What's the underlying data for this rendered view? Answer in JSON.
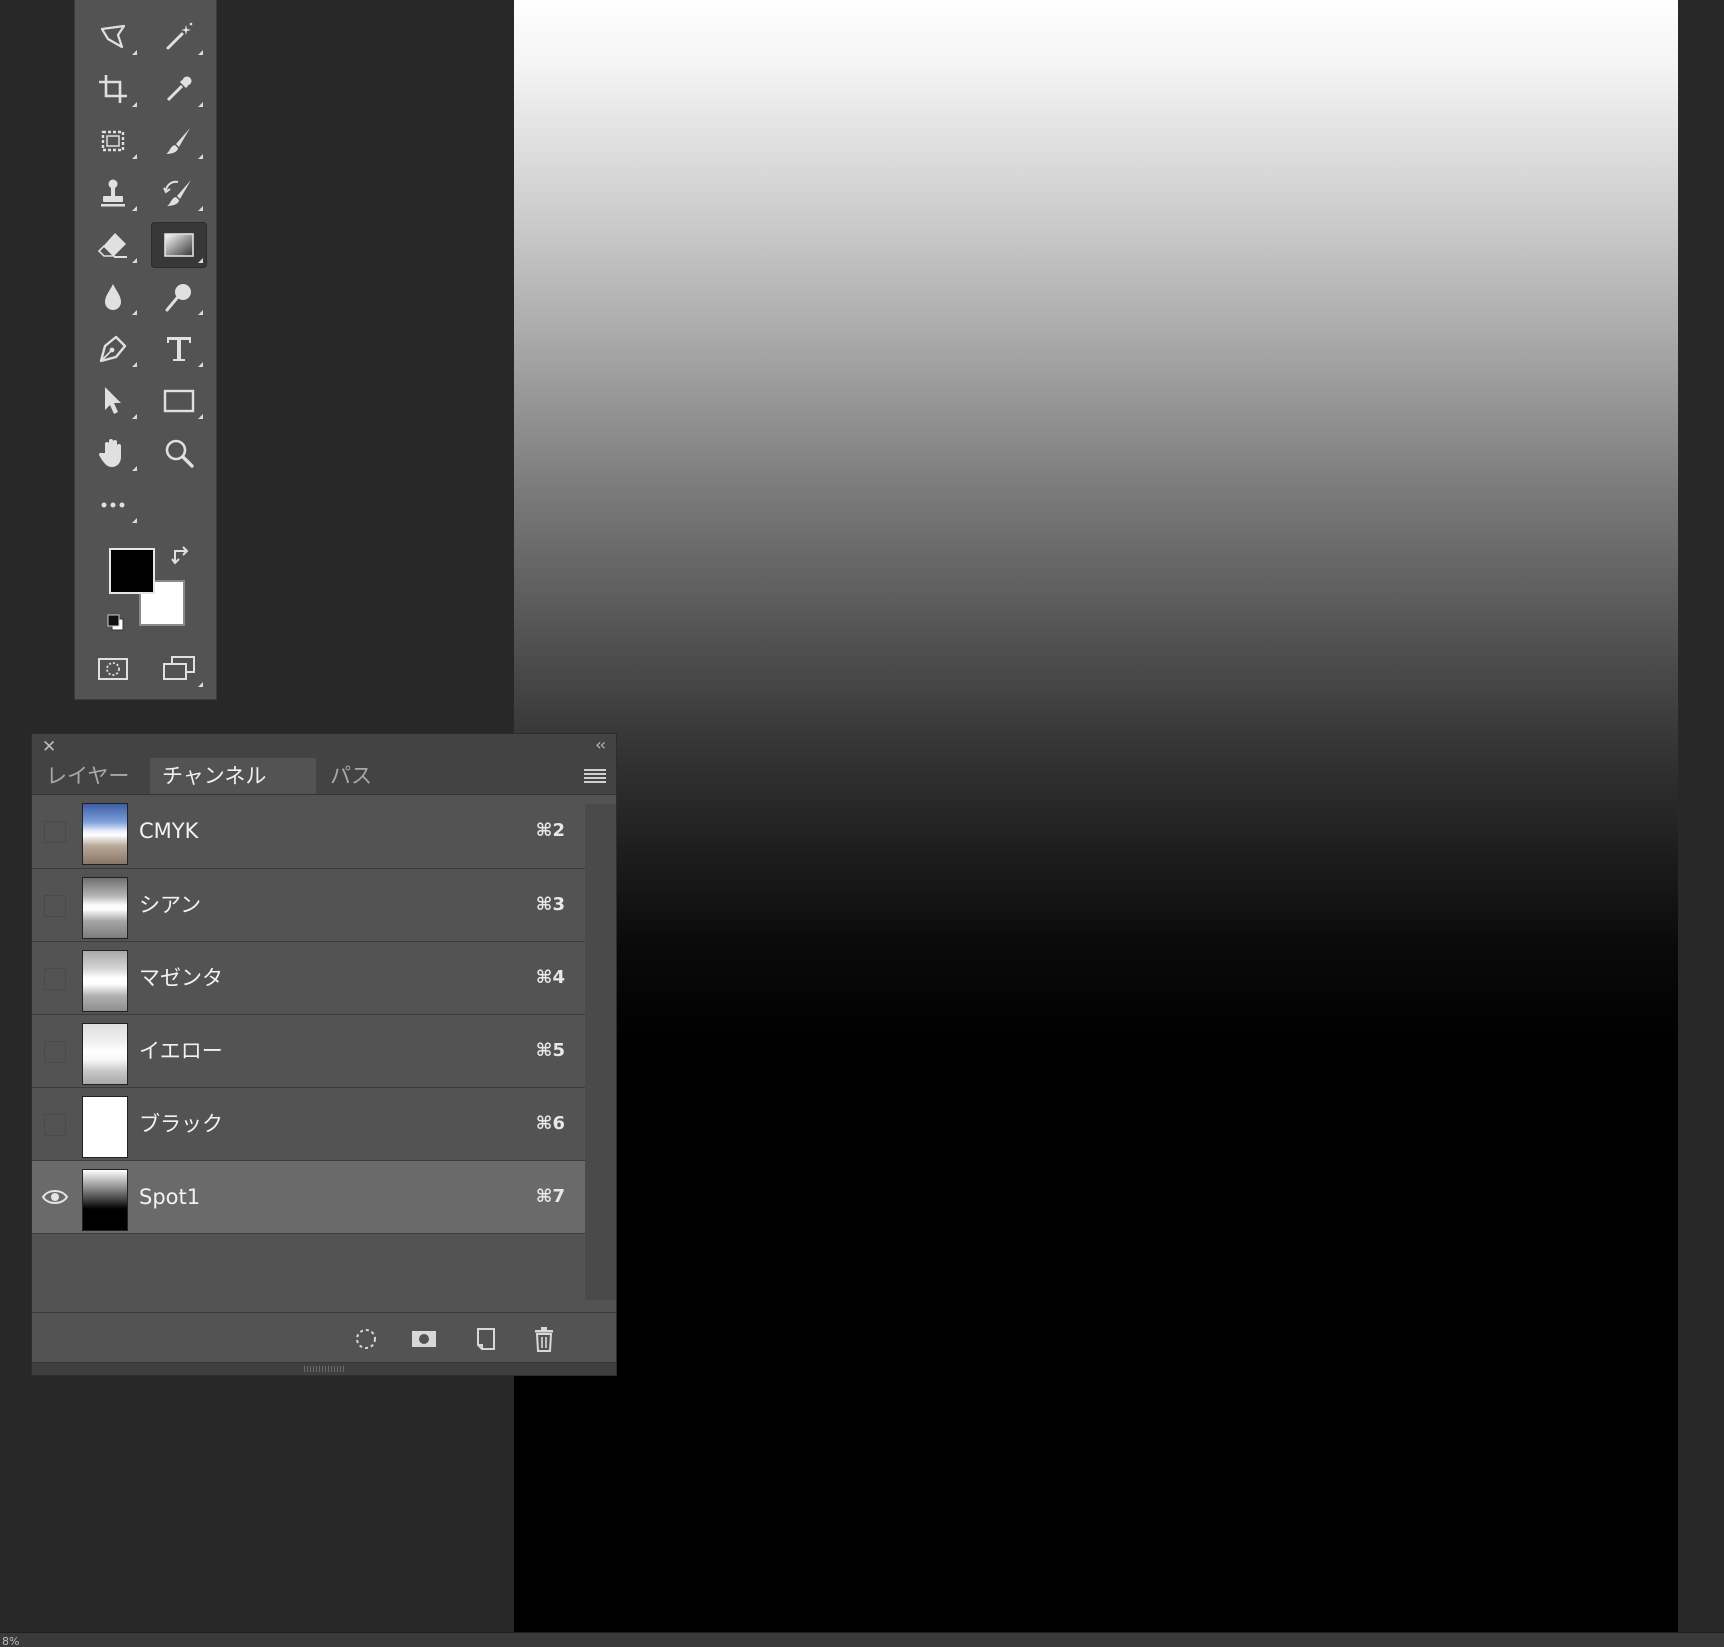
{
  "panel": {
    "tabs": [
      {
        "label": "レイヤー"
      },
      {
        "label": "チャンネル"
      },
      {
        "label": "パス"
      }
    ],
    "channels": [
      {
        "name": "CMYK",
        "shortcut": "⌘2",
        "visible": false
      },
      {
        "name": "シアン",
        "shortcut": "⌘3",
        "visible": false
      },
      {
        "name": "マゼンタ",
        "shortcut": "⌘4",
        "visible": false
      },
      {
        "name": "イエロー",
        "shortcut": "⌘5",
        "visible": false
      },
      {
        "name": "ブラック",
        "shortcut": "⌘6",
        "visible": false
      },
      {
        "name": "Spot1",
        "shortcut": "⌘7",
        "visible": true
      }
    ]
  },
  "status": {
    "zoom": "8%"
  },
  "colors": {
    "foreground": "#000000",
    "background": "#ffffff",
    "ui_bg": "#282828",
    "panel_bg": "#535353",
    "selected_row": "#6a6a6a"
  },
  "icons": [
    "lasso-icon",
    "magic-wand-icon",
    "crop-icon",
    "eyedropper-icon",
    "healing-brush-icon",
    "brush-icon",
    "clone-stamp-icon",
    "history-brush-icon",
    "eraser-icon",
    "gradient-icon",
    "blur-icon",
    "dodge-icon",
    "pen-icon",
    "type-icon",
    "path-selection-icon",
    "rectangle-icon",
    "hand-icon",
    "zoom-icon",
    "more-icon",
    "quick-mask-icon",
    "screen-mode-icon",
    "eye-icon",
    "load-selection-icon",
    "save-selection-icon",
    "new-channel-icon",
    "trash-icon"
  ]
}
